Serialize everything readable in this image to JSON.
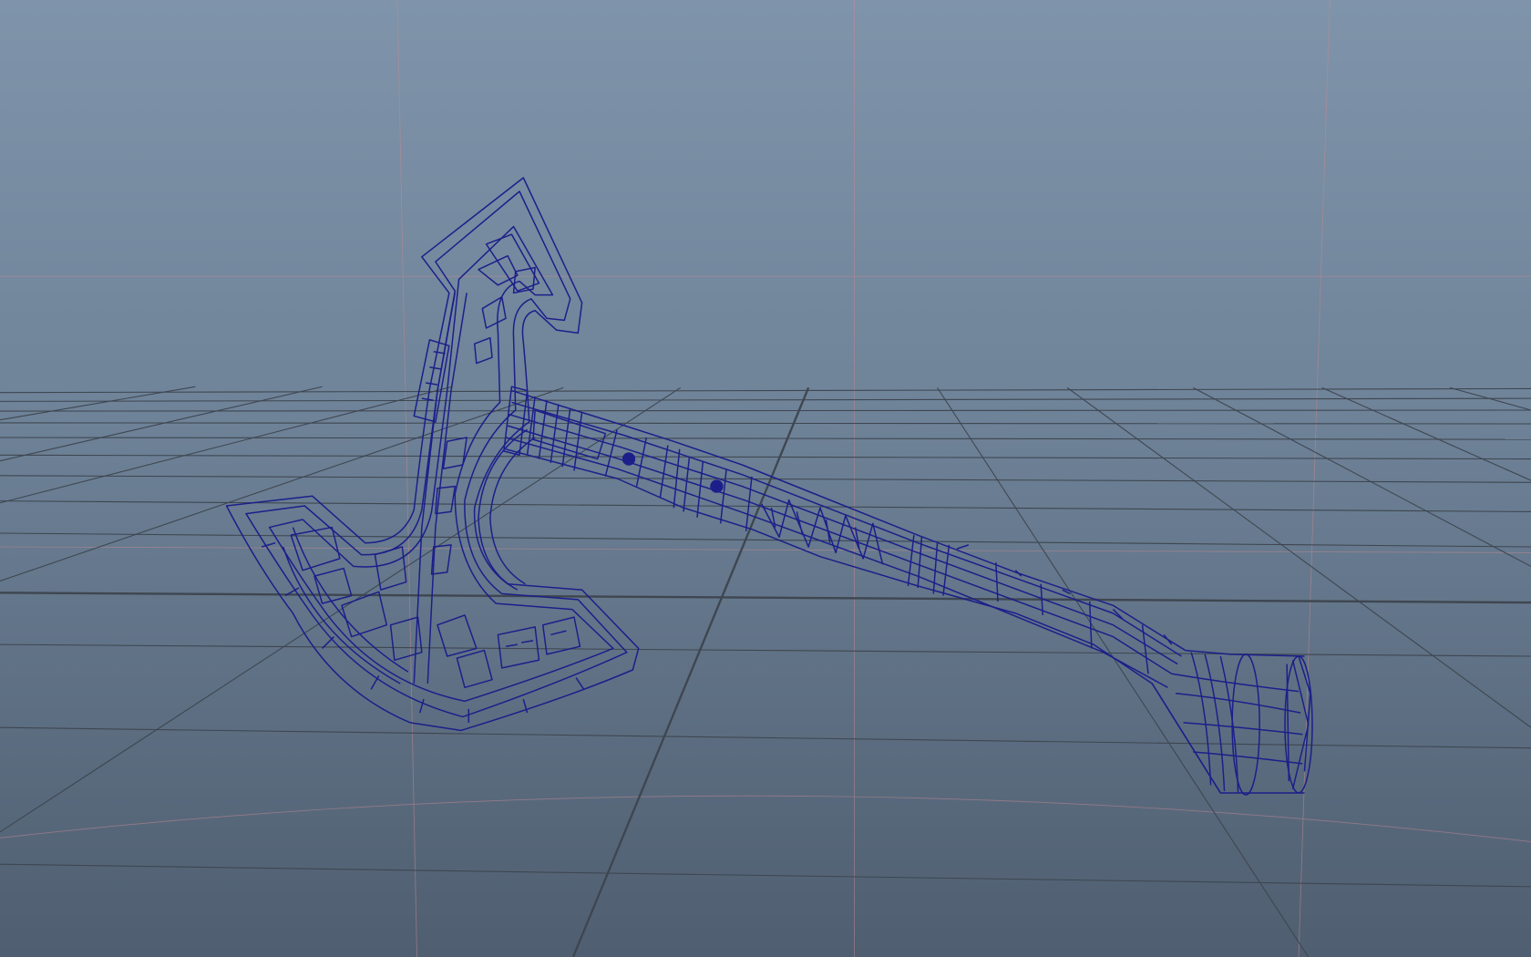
{
  "viewport": {
    "name": "maya-perspective-viewport",
    "background_top_color": "#7f94aa",
    "background_bottom_color": "#4f5e70",
    "grid_line_color": "#3e4650",
    "axis_guide_color": "#c48a92",
    "wireframe_color": "#1c1f8a",
    "display_mode": "wireframe",
    "grid_visible": true
  },
  "model": {
    "object": "axe",
    "parts": [
      "axe-head",
      "axe-handle",
      "handle-pommel"
    ]
  }
}
